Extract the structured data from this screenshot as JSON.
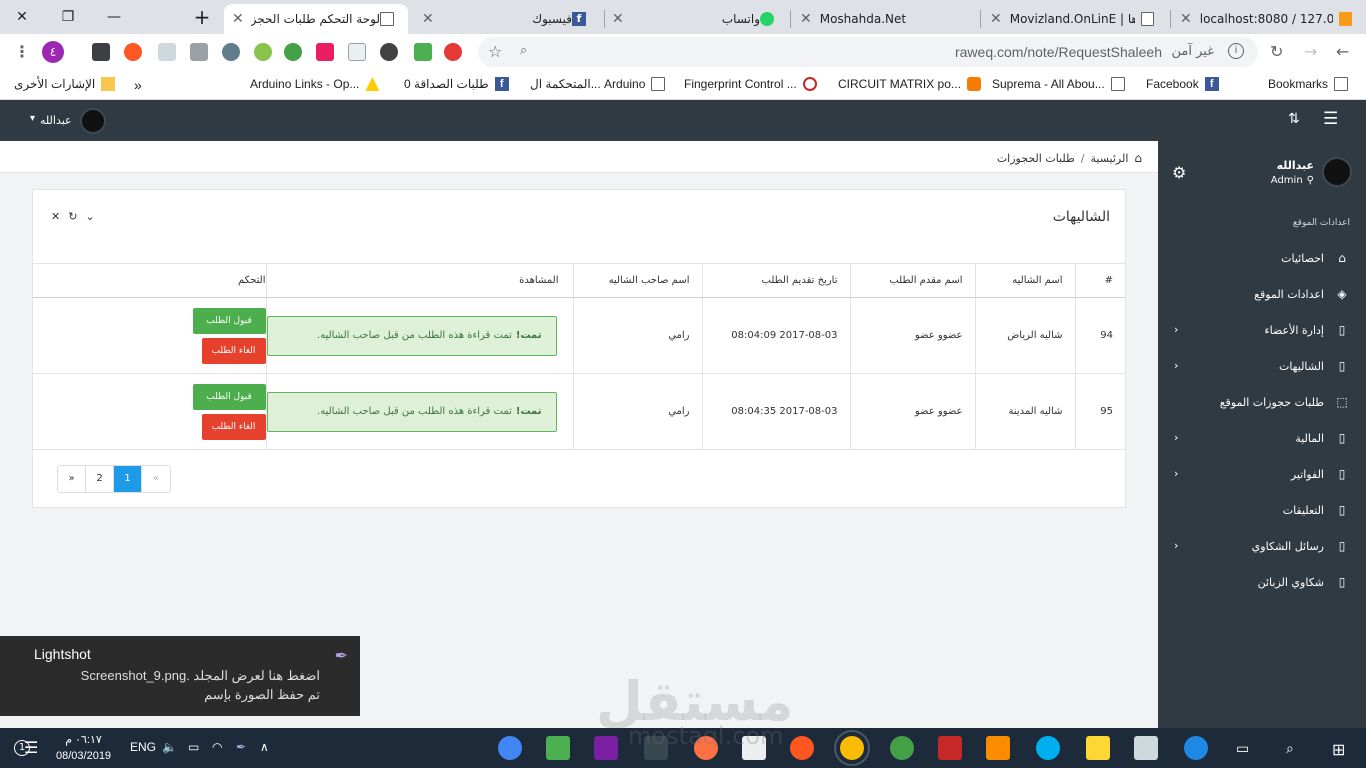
{
  "browser": {
    "tabs": [
      {
        "title": "localhost:8080 / 127.0.0",
        "active": false
      },
      {
        "title": "Movizland.OnLinE | برها",
        "active": false
      },
      {
        "title": "Moshahda.Net",
        "active": false
      },
      {
        "title": "واتساب",
        "active": false
      },
      {
        "title": "فيسبوك",
        "active": false
      },
      {
        "title": "لوحة التحكم طلبات الحجز",
        "active": true
      }
    ],
    "new_tab": "+",
    "url": "raweq.com/note/RequestShaleeh",
    "not_secure": "غير آمن",
    "profile_badge": "٤",
    "bookmarks": [
      {
        "label": "Bookmarks"
      },
      {
        "label": "Facebook"
      },
      {
        "label": "Suprema - All Abou..."
      },
      {
        "label": "CIRCUIT MATRIX po..."
      },
      {
        "label": "Fingerprint Control ..."
      },
      {
        "label": "المتحكمة ال... Arduino"
      },
      {
        "label": "0 طلبات الصداقة"
      },
      {
        "label": "Arduino Links - Op..."
      }
    ],
    "other_bookmarks": "الإشارات الأخرى",
    "bookmarks_more": "»"
  },
  "header": {
    "user_name": "عبدالله"
  },
  "sidebar": {
    "profile_name": "عبدالله",
    "profile_role": "Admin",
    "section_title": "اعدادات الموقع",
    "items": [
      {
        "label": "احصائيات",
        "icon": "home-icon",
        "has_arrow": false
      },
      {
        "label": "اعدادات الموقع",
        "icon": "layers-icon",
        "has_arrow": false
      },
      {
        "label": "إدارة الأعضاء",
        "icon": "clipboard-icon",
        "has_arrow": true
      },
      {
        "label": "الشاليهات",
        "icon": "clipboard-icon",
        "has_arrow": true
      },
      {
        "label": "طلبات حجوزات الموقع",
        "icon": "tag-icon",
        "has_arrow": false
      },
      {
        "label": "المالية",
        "icon": "clipboard-icon",
        "has_arrow": true
      },
      {
        "label": "الفواتير",
        "icon": "clipboard-icon",
        "has_arrow": true
      },
      {
        "label": "التعليقات",
        "icon": "clipboard-icon",
        "has_arrow": false
      },
      {
        "label": "رسائل الشكاوي",
        "icon": "clipboard-icon",
        "has_arrow": true
      },
      {
        "label": "شكاوي الزبائن",
        "icon": "clipboard-icon",
        "has_arrow": false
      }
    ]
  },
  "breadcrumb": {
    "home": "الرئيسية",
    "separator": "/",
    "current": "طلبات الحجوزات"
  },
  "card": {
    "title": "الشاليهات",
    "columns": [
      "#",
      "اسم الشاليه",
      "اسم مقدم الطلب",
      "تاريخ تقديم الطلب",
      "اسم صاحب الشاليه",
      "المشاهدة",
      "التحكم"
    ],
    "rows": [
      {
        "id": "94",
        "chalet": "شاليه الرياض",
        "applicant": "عضوو عضو",
        "date": "2017-08-03 08:04:09",
        "owner": "رامي",
        "alert_strong": "تمت!",
        "alert_text": "تمت قراءة هذه الطلب من قبل صاحب الشاليه.",
        "accept": "قبول الطلب",
        "cancel": "الغاء الطلب"
      },
      {
        "id": "95",
        "chalet": "شاليه المدينة",
        "applicant": "عضوو عضو",
        "date": "2017-08-03 08:04:35",
        "owner": "رامي",
        "alert_strong": "تمت!",
        "alert_text": "تمت قراءة هذه الطلب من قبل صاحب الشاليه.",
        "accept": "قبول الطلب",
        "cancel": "الغاء الطلب"
      }
    ]
  },
  "pagination": {
    "prev": "«",
    "pages": [
      "1",
      "2"
    ],
    "active": "1",
    "next": "»"
  },
  "lightshot": {
    "title": "Lightshot",
    "line1": "اضغط هنا لعرض المجلد .Screenshot_9.png",
    "line2": "تم حفظ الصورة بإسم"
  },
  "taskbar": {
    "time": "٠٦:١٧ م",
    "date": "08/03/2019",
    "lang": "ENG"
  },
  "watermark": {
    "arabic": "مستقل",
    "latin": "mostaql.com"
  },
  "colors": {
    "header_bg": "#2f3a43",
    "accept": "#4cae4c",
    "cancel": "#e5412d",
    "alert_bg": "#dff0d8",
    "pager_active": "#1e9be8"
  }
}
